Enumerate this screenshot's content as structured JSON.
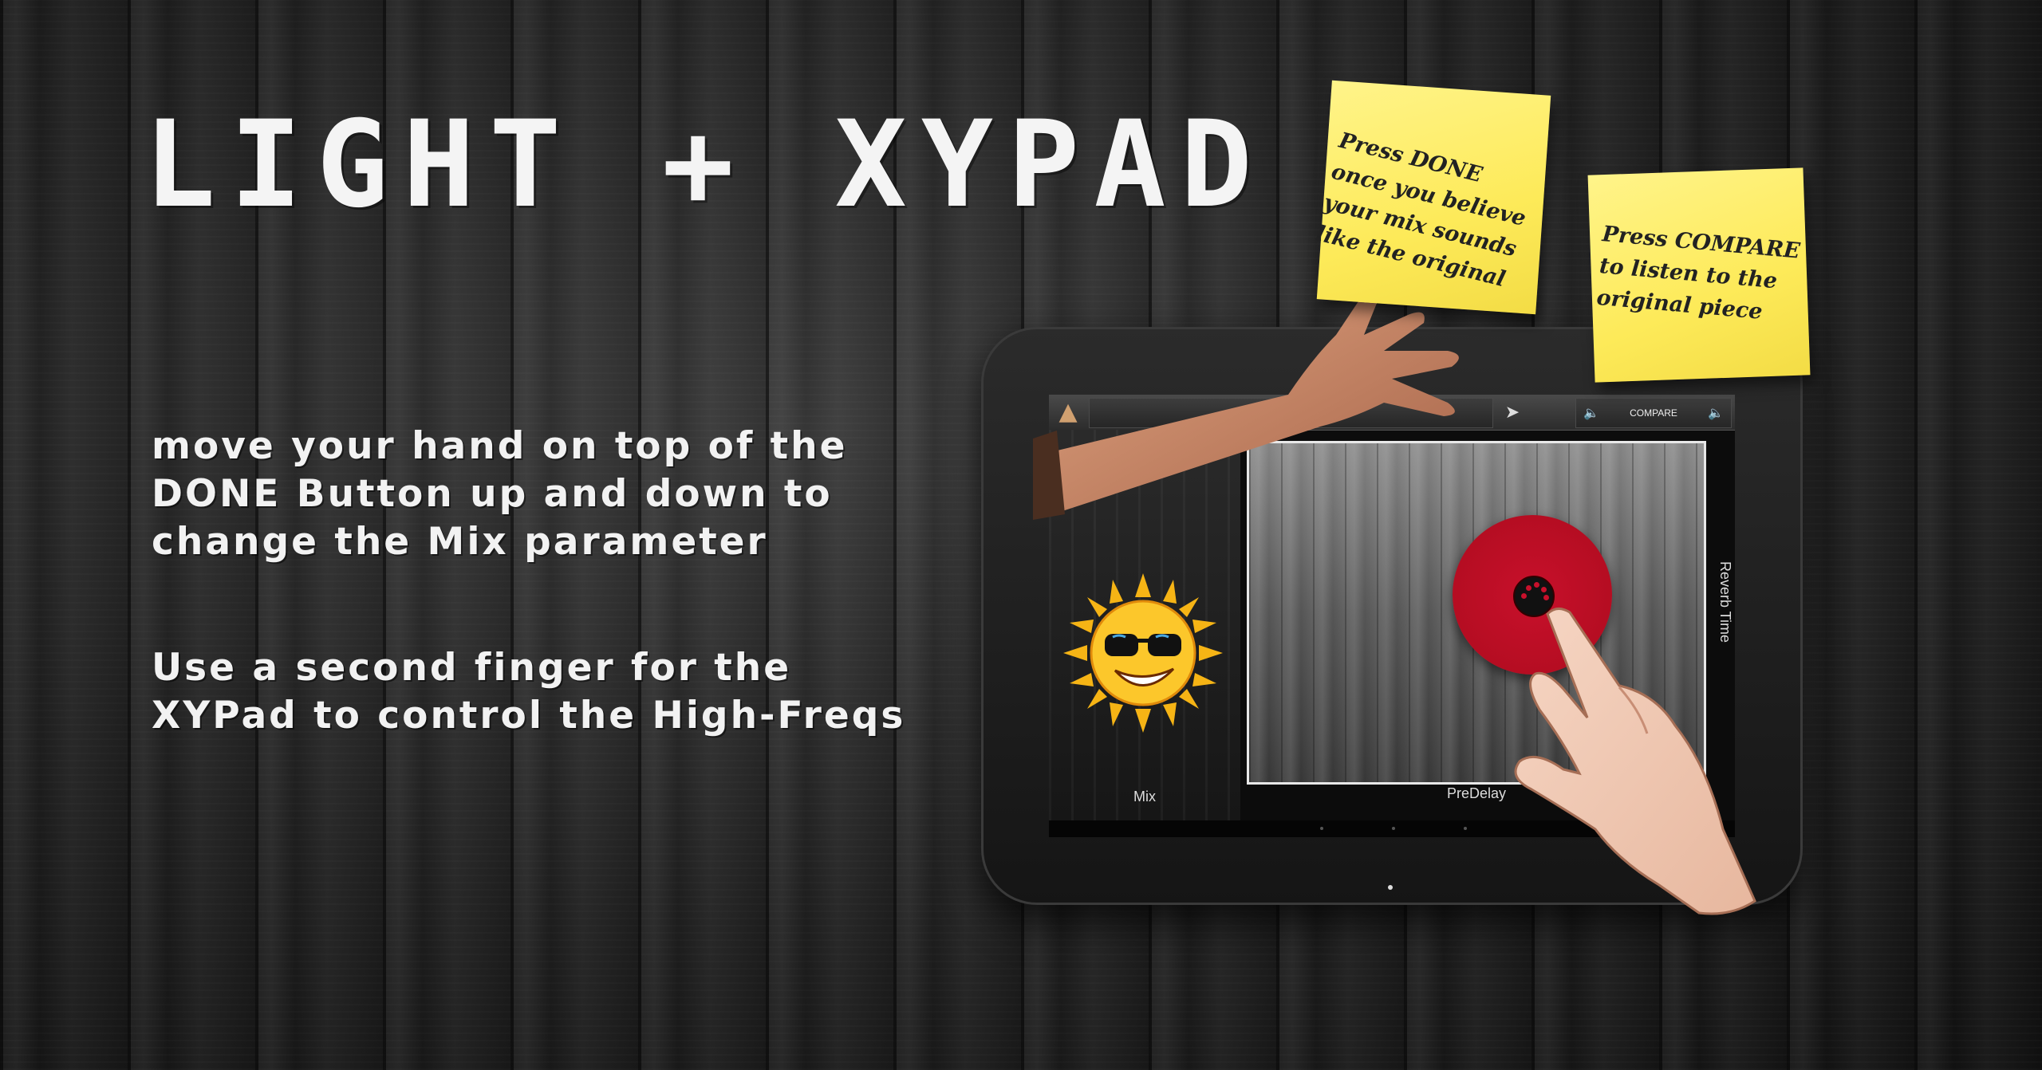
{
  "headline": "LIGHT + XYPAD",
  "instructions": {
    "para1": [
      "move your hand on top of the",
      "DONE Button up and down to",
      "change the Mix parameter"
    ],
    "para2": [
      "Use a second finger for the",
      "XYPad to control the High-Freqs"
    ]
  },
  "notes": {
    "done": [
      "Press DONE",
      "once you believe",
      "your mix sounds",
      "like the original"
    ],
    "compare": [
      "Press COMPARE",
      "to listen to the",
      "original piece"
    ]
  },
  "app": {
    "compare_label": "COMPARE",
    "mix_label": "Mix",
    "predelay_label": "PreDelay",
    "reverb_label": "Reverb Time",
    "play_icon": "play-icon",
    "speaker_icon": "speaker-icon"
  },
  "colors": {
    "knob": "#c8102b",
    "note": "#fdea59",
    "xypad_border": "#e8e8e8"
  }
}
